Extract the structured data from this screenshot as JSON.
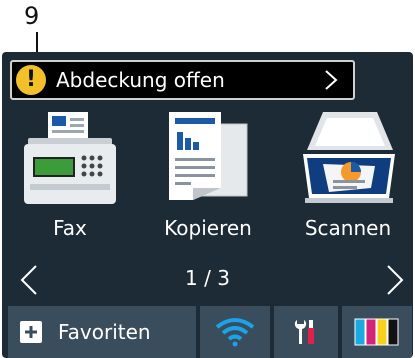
{
  "callout": {
    "number": "9"
  },
  "status_bar": {
    "icon": "warning-icon",
    "text": "Abdeckung offen"
  },
  "apps": [
    {
      "label": "Fax",
      "icon": "fax-icon"
    },
    {
      "label": "Kopieren",
      "icon": "copy-icon"
    },
    {
      "label": "Scannen",
      "icon": "scanner-icon"
    }
  ],
  "nav": {
    "page_indicator": "1 / 3"
  },
  "bottom_bar": {
    "favorites_label": "Favoriten",
    "icons": [
      "plus-icon",
      "wifi-icon",
      "tools-icon",
      "ink-icon"
    ]
  },
  "colors": {
    "screen_bg": "#1d2b36",
    "button_bg": "#3a4d5c",
    "warning": "#f4c02a",
    "wifi": "#1aa3e8",
    "ink_cyan": "#1aa9e0",
    "ink_magenta": "#d4237a",
    "ink_yellow": "#f6d21f",
    "ink_black": "#111111"
  }
}
